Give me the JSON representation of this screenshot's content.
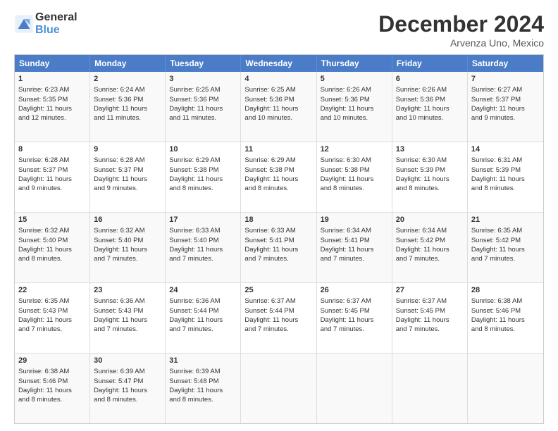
{
  "logo": {
    "line1": "General",
    "line2": "Blue"
  },
  "title": "December 2024",
  "location": "Arvenza Uno, Mexico",
  "headers": [
    "Sunday",
    "Monday",
    "Tuesday",
    "Wednesday",
    "Thursday",
    "Friday",
    "Saturday"
  ],
  "rows": [
    [
      {
        "day": "1",
        "lines": [
          "Sunrise: 6:23 AM",
          "Sunset: 5:35 PM",
          "Daylight: 11 hours",
          "and 12 minutes."
        ]
      },
      {
        "day": "2",
        "lines": [
          "Sunrise: 6:24 AM",
          "Sunset: 5:36 PM",
          "Daylight: 11 hours",
          "and 11 minutes."
        ]
      },
      {
        "day": "3",
        "lines": [
          "Sunrise: 6:25 AM",
          "Sunset: 5:36 PM",
          "Daylight: 11 hours",
          "and 11 minutes."
        ]
      },
      {
        "day": "4",
        "lines": [
          "Sunrise: 6:25 AM",
          "Sunset: 5:36 PM",
          "Daylight: 11 hours",
          "and 10 minutes."
        ]
      },
      {
        "day": "5",
        "lines": [
          "Sunrise: 6:26 AM",
          "Sunset: 5:36 PM",
          "Daylight: 11 hours",
          "and 10 minutes."
        ]
      },
      {
        "day": "6",
        "lines": [
          "Sunrise: 6:26 AM",
          "Sunset: 5:36 PM",
          "Daylight: 11 hours",
          "and 10 minutes."
        ]
      },
      {
        "day": "7",
        "lines": [
          "Sunrise: 6:27 AM",
          "Sunset: 5:37 PM",
          "Daylight: 11 hours",
          "and 9 minutes."
        ]
      }
    ],
    [
      {
        "day": "8",
        "lines": [
          "Sunrise: 6:28 AM",
          "Sunset: 5:37 PM",
          "Daylight: 11 hours",
          "and 9 minutes."
        ]
      },
      {
        "day": "9",
        "lines": [
          "Sunrise: 6:28 AM",
          "Sunset: 5:37 PM",
          "Daylight: 11 hours",
          "and 9 minutes."
        ]
      },
      {
        "day": "10",
        "lines": [
          "Sunrise: 6:29 AM",
          "Sunset: 5:38 PM",
          "Daylight: 11 hours",
          "and 8 minutes."
        ]
      },
      {
        "day": "11",
        "lines": [
          "Sunrise: 6:29 AM",
          "Sunset: 5:38 PM",
          "Daylight: 11 hours",
          "and 8 minutes."
        ]
      },
      {
        "day": "12",
        "lines": [
          "Sunrise: 6:30 AM",
          "Sunset: 5:38 PM",
          "Daylight: 11 hours",
          "and 8 minutes."
        ]
      },
      {
        "day": "13",
        "lines": [
          "Sunrise: 6:30 AM",
          "Sunset: 5:39 PM",
          "Daylight: 11 hours",
          "and 8 minutes."
        ]
      },
      {
        "day": "14",
        "lines": [
          "Sunrise: 6:31 AM",
          "Sunset: 5:39 PM",
          "Daylight: 11 hours",
          "and 8 minutes."
        ]
      }
    ],
    [
      {
        "day": "15",
        "lines": [
          "Sunrise: 6:32 AM",
          "Sunset: 5:40 PM",
          "Daylight: 11 hours",
          "and 8 minutes."
        ]
      },
      {
        "day": "16",
        "lines": [
          "Sunrise: 6:32 AM",
          "Sunset: 5:40 PM",
          "Daylight: 11 hours",
          "and 7 minutes."
        ]
      },
      {
        "day": "17",
        "lines": [
          "Sunrise: 6:33 AM",
          "Sunset: 5:40 PM",
          "Daylight: 11 hours",
          "and 7 minutes."
        ]
      },
      {
        "day": "18",
        "lines": [
          "Sunrise: 6:33 AM",
          "Sunset: 5:41 PM",
          "Daylight: 11 hours",
          "and 7 minutes."
        ]
      },
      {
        "day": "19",
        "lines": [
          "Sunrise: 6:34 AM",
          "Sunset: 5:41 PM",
          "Daylight: 11 hours",
          "and 7 minutes."
        ]
      },
      {
        "day": "20",
        "lines": [
          "Sunrise: 6:34 AM",
          "Sunset: 5:42 PM",
          "Daylight: 11 hours",
          "and 7 minutes."
        ]
      },
      {
        "day": "21",
        "lines": [
          "Sunrise: 6:35 AM",
          "Sunset: 5:42 PM",
          "Daylight: 11 hours",
          "and 7 minutes."
        ]
      }
    ],
    [
      {
        "day": "22",
        "lines": [
          "Sunrise: 6:35 AM",
          "Sunset: 5:43 PM",
          "Daylight: 11 hours",
          "and 7 minutes."
        ]
      },
      {
        "day": "23",
        "lines": [
          "Sunrise: 6:36 AM",
          "Sunset: 5:43 PM",
          "Daylight: 11 hours",
          "and 7 minutes."
        ]
      },
      {
        "day": "24",
        "lines": [
          "Sunrise: 6:36 AM",
          "Sunset: 5:44 PM",
          "Daylight: 11 hours",
          "and 7 minutes."
        ]
      },
      {
        "day": "25",
        "lines": [
          "Sunrise: 6:37 AM",
          "Sunset: 5:44 PM",
          "Daylight: 11 hours",
          "and 7 minutes."
        ]
      },
      {
        "day": "26",
        "lines": [
          "Sunrise: 6:37 AM",
          "Sunset: 5:45 PM",
          "Daylight: 11 hours",
          "and 7 minutes."
        ]
      },
      {
        "day": "27",
        "lines": [
          "Sunrise: 6:37 AM",
          "Sunset: 5:45 PM",
          "Daylight: 11 hours",
          "and 7 minutes."
        ]
      },
      {
        "day": "28",
        "lines": [
          "Sunrise: 6:38 AM",
          "Sunset: 5:46 PM",
          "Daylight: 11 hours",
          "and 8 minutes."
        ]
      }
    ],
    [
      {
        "day": "29",
        "lines": [
          "Sunrise: 6:38 AM",
          "Sunset: 5:46 PM",
          "Daylight: 11 hours",
          "and 8 minutes."
        ]
      },
      {
        "day": "30",
        "lines": [
          "Sunrise: 6:39 AM",
          "Sunset: 5:47 PM",
          "Daylight: 11 hours",
          "and 8 minutes."
        ]
      },
      {
        "day": "31",
        "lines": [
          "Sunrise: 6:39 AM",
          "Sunset: 5:48 PM",
          "Daylight: 11 hours",
          "and 8 minutes."
        ]
      },
      {
        "day": "",
        "lines": []
      },
      {
        "day": "",
        "lines": []
      },
      {
        "day": "",
        "lines": []
      },
      {
        "day": "",
        "lines": []
      }
    ]
  ]
}
